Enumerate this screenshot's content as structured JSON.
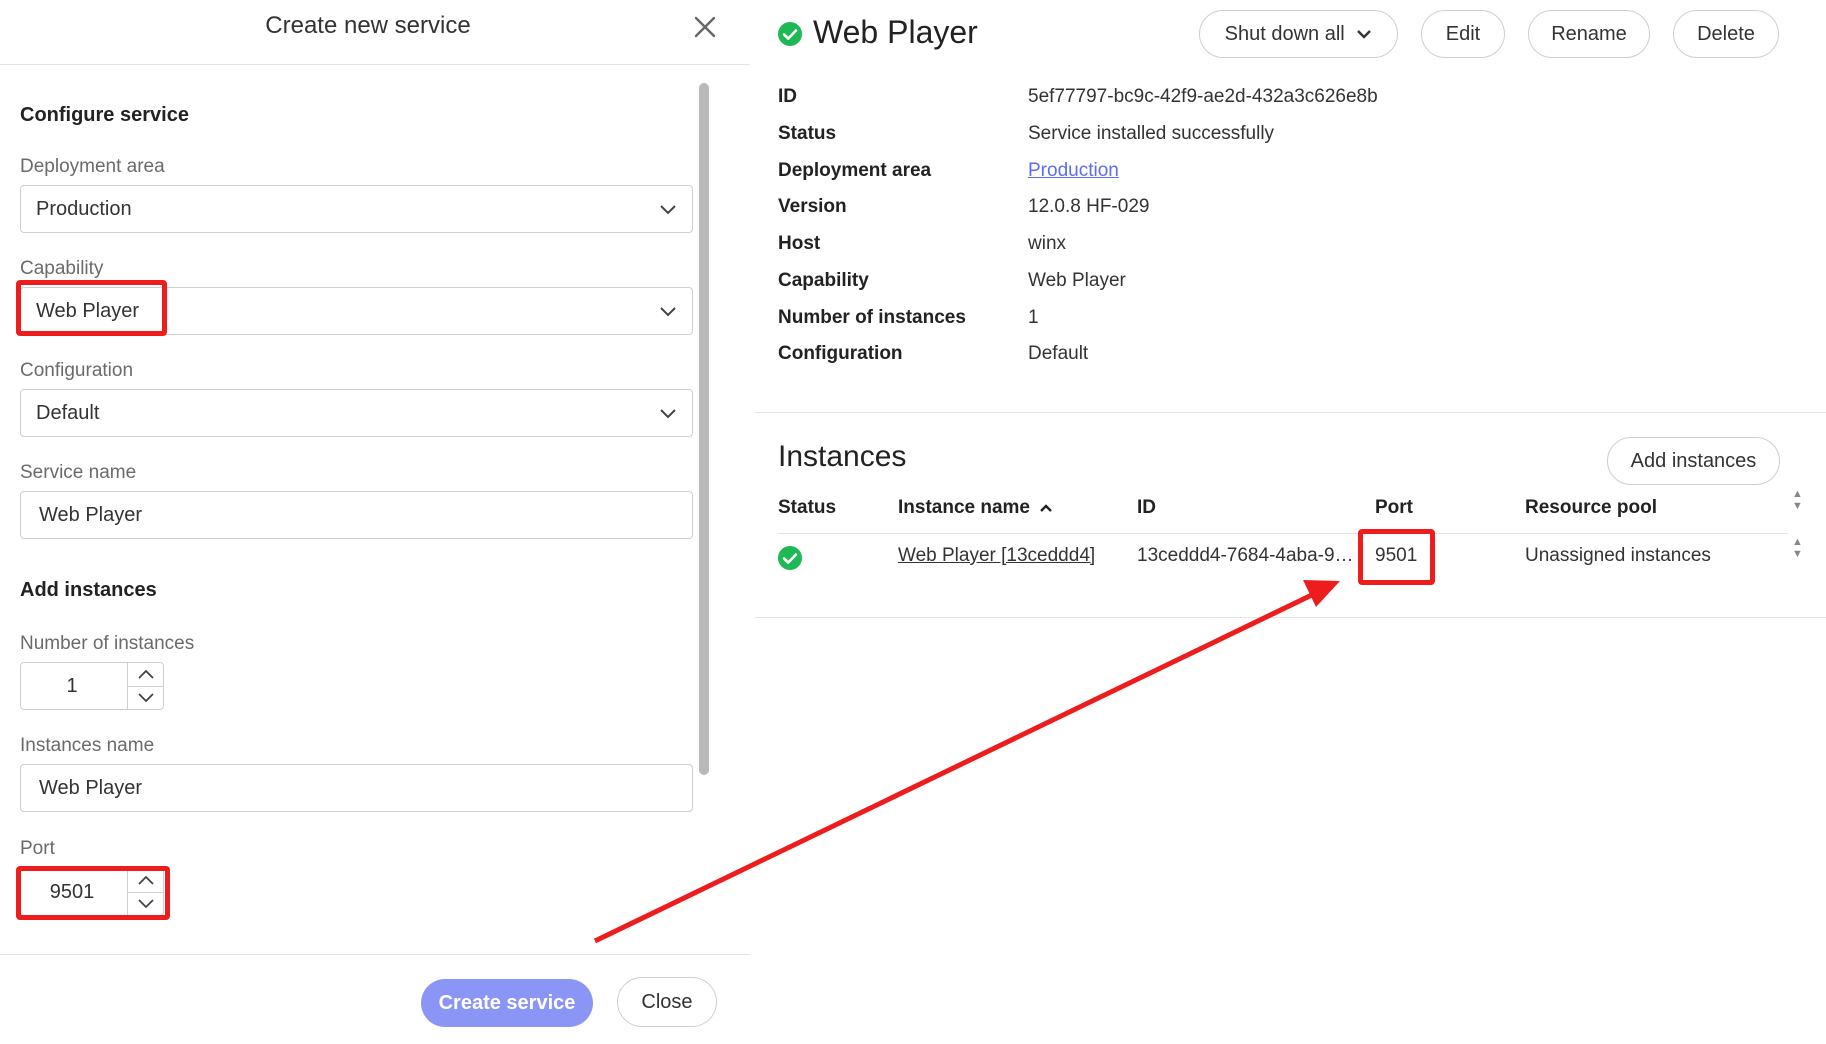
{
  "modal": {
    "title": "Create new service",
    "configure_heading": "Configure service",
    "deployment_area": {
      "label": "Deployment area",
      "value": "Production"
    },
    "capability": {
      "label": "Capability",
      "value": "Web Player"
    },
    "configuration": {
      "label": "Configuration",
      "value": "Default"
    },
    "service_name": {
      "label": "Service name",
      "value": "Web Player"
    },
    "add_instances_heading": "Add instances",
    "number_of_instances": {
      "label": "Number of instances",
      "value": "1"
    },
    "instances_name": {
      "label": "Instances name",
      "value": "Web Player"
    },
    "port": {
      "label": "Port",
      "value": "9501"
    },
    "create_button": "Create service",
    "close_button": "Close"
  },
  "service": {
    "title": "Web Player",
    "actions": {
      "shutdown": "Shut down all",
      "edit": "Edit",
      "rename": "Rename",
      "delete": "Delete"
    },
    "details": [
      {
        "key": "ID",
        "value": "5ef77797-bc9c-42f9-ae2d-432a3c626e8b"
      },
      {
        "key": "Status",
        "value": "Service installed successfully"
      },
      {
        "key": "Deployment area",
        "value": "Production"
      },
      {
        "key": "Version",
        "value": "12.0.8 HF-029"
      },
      {
        "key": "Host",
        "value": "winx"
      },
      {
        "key": "Capability",
        "value": "Web Player"
      },
      {
        "key": "Number of instances",
        "value": "1"
      },
      {
        "key": "Configuration",
        "value": "Default"
      }
    ]
  },
  "instances": {
    "title": "Instances",
    "add_button": "Add instances",
    "columns": [
      "Status",
      "Instance name",
      "ID",
      "Port",
      "Resource pool"
    ],
    "rows": [
      {
        "name": "Web Player [13ceddd4]",
        "id": "13ceddd4-7684-4aba-9…",
        "port": "9501",
        "pool": "Unassigned instances"
      }
    ]
  },
  "colors": {
    "accent": "#8b95f5",
    "link": "#5b6df0",
    "success": "#1db954",
    "highlight": "#ee1d1d"
  }
}
